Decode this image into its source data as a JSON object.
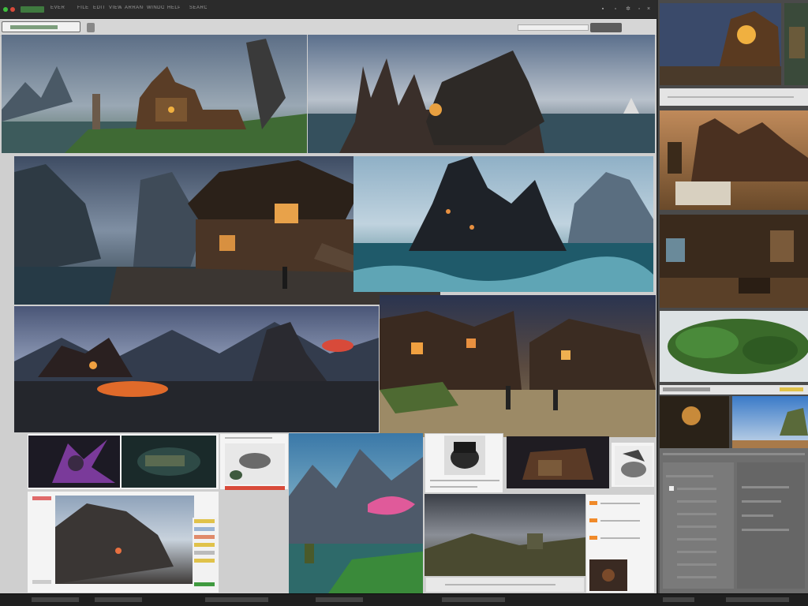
{
  "app": {
    "title": "EVER",
    "menu": [
      "FILE",
      "EDIT",
      "VIEW",
      "ARRANGE",
      "WINDOW",
      "HELP",
      "SEARCH"
    ]
  },
  "toolbar": {
    "search_placeholder": "",
    "button_label": "",
    "zoom_label": ""
  },
  "colors": {
    "chrome": "#2b2b2b",
    "canvas": "#cfcfcf",
    "accent_green": "#3f7a3f",
    "accent_yellow": "#e0c24a",
    "accent_red": "#d84a3a",
    "accent_orange": "#f08a2a"
  },
  "icons": {
    "record": "record-dot-icon",
    "minimize": "minimize-icon",
    "maximize": "maximize-icon",
    "close": "close-icon",
    "settings": "gear-icon"
  },
  "images": [
    {
      "name": "coastal-castle-village",
      "caption": ""
    },
    {
      "name": "ship-fortress-storm",
      "caption": ""
    },
    {
      "name": "wooden-house-shore",
      "caption": ""
    },
    {
      "name": "dark-tower-sea",
      "caption": ""
    },
    {
      "name": "burning-town-night",
      "caption": ""
    },
    {
      "name": "village-square-evening",
      "caption": ""
    },
    {
      "name": "purple-creature",
      "caption": ""
    },
    {
      "name": "underground-machine",
      "caption": ""
    },
    {
      "name": "creature-sketches",
      "caption": ""
    },
    {
      "name": "waterfall-valley",
      "caption": ""
    },
    {
      "name": "cauldron-object",
      "caption": ""
    },
    {
      "name": "ruined-shack",
      "caption": ""
    },
    {
      "name": "rocky-cliffs",
      "caption": ""
    },
    {
      "name": "stormy-hills",
      "caption": ""
    },
    {
      "name": "golden-village-interior",
      "caption": ""
    },
    {
      "name": "desert-castle",
      "caption": ""
    },
    {
      "name": "tavern-interior",
      "caption": ""
    },
    {
      "name": "jungle-foliage",
      "caption": ""
    },
    {
      "name": "cave-glow",
      "caption": ""
    },
    {
      "name": "sky-island",
      "caption": ""
    }
  ],
  "panel": {
    "settings": [
      "",
      "",
      "",
      "",
      "",
      "",
      "",
      "",
      ""
    ]
  }
}
